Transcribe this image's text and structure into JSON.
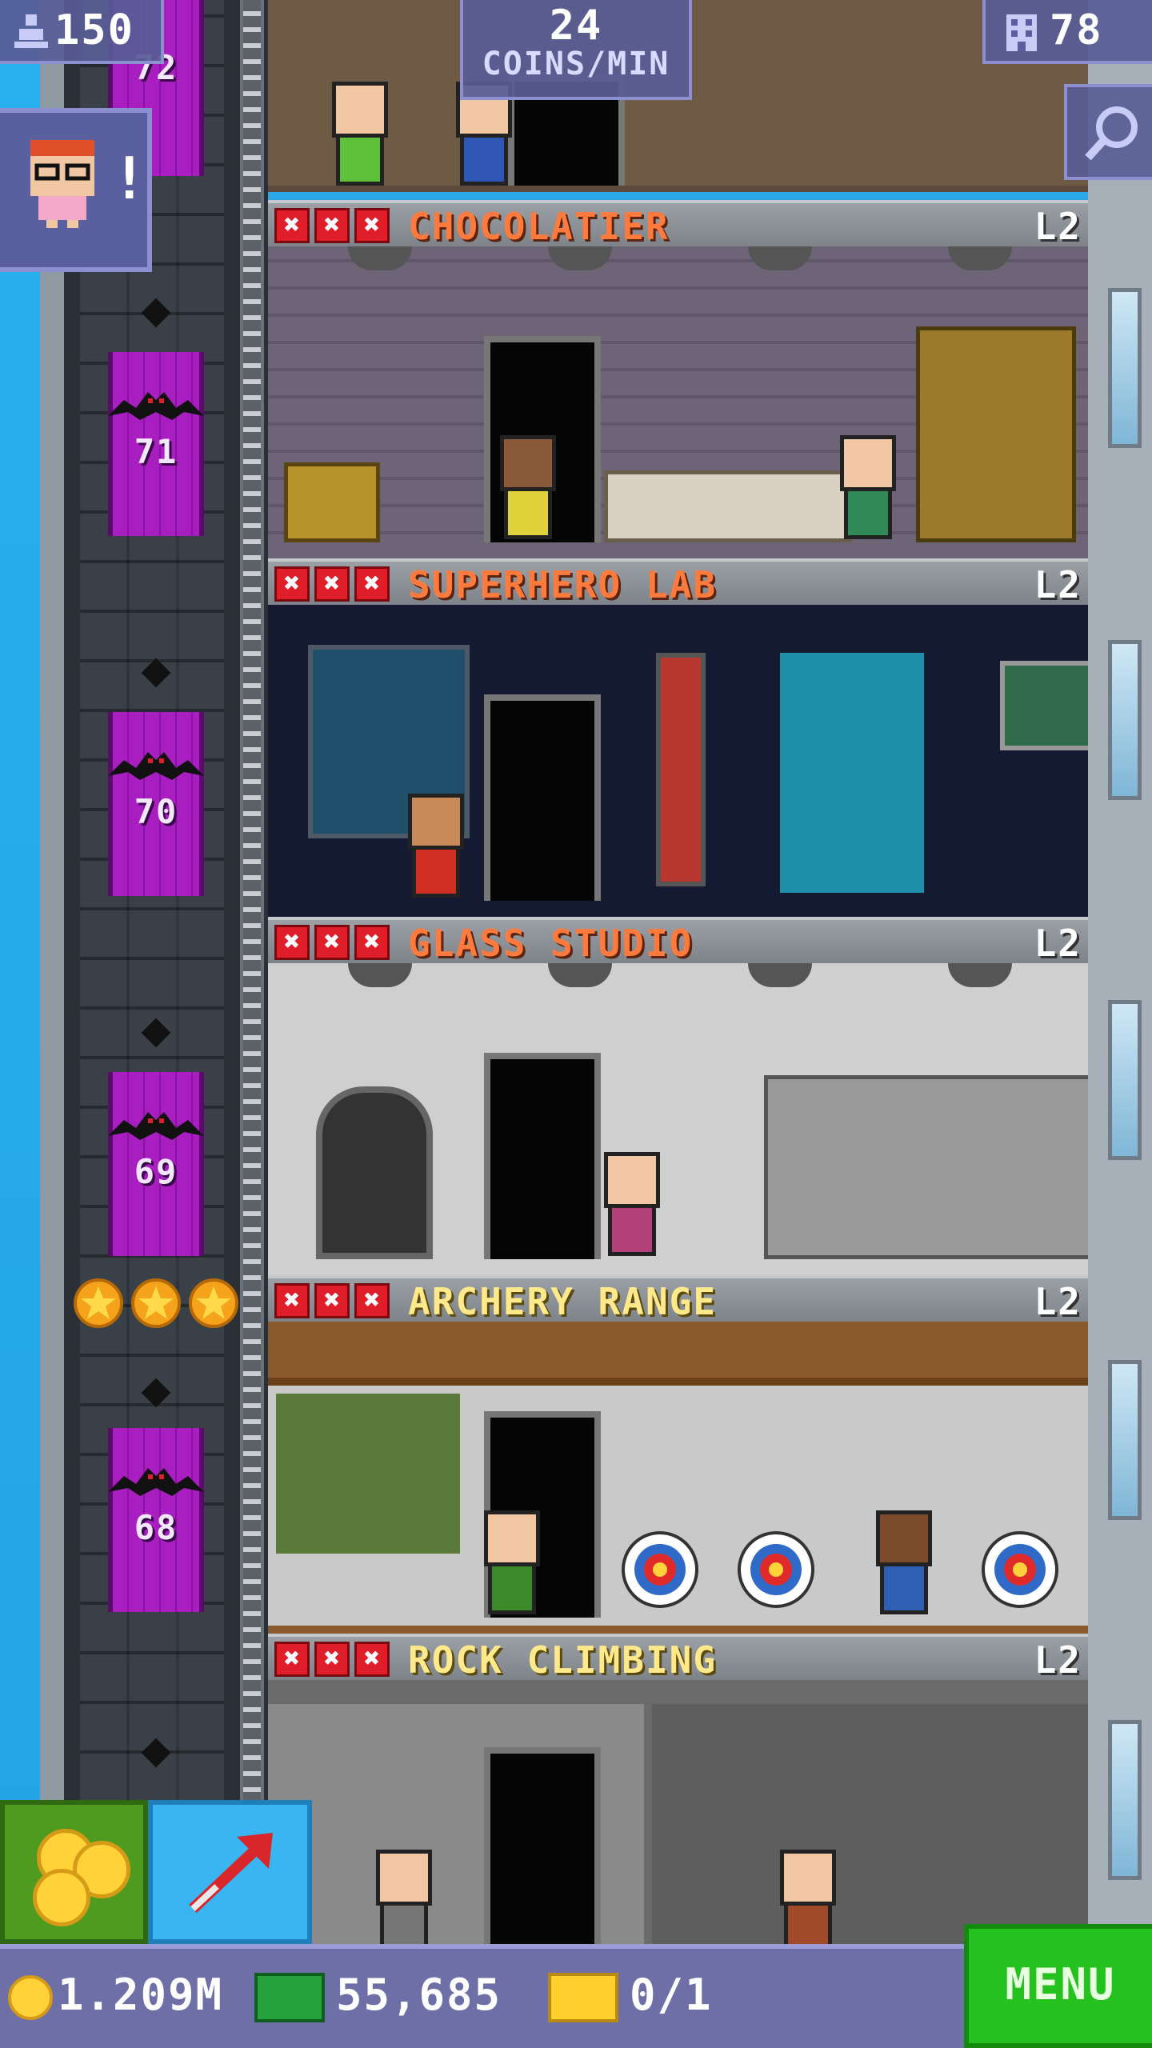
{
  "hud": {
    "population": "150",
    "coins_per_min_value": "24",
    "coins_per_min_label": "COINS/MIN",
    "floors_count": "78",
    "icons": {
      "population": "people-icon",
      "floors": "building-icon",
      "zoom": "magnify-icon"
    }
  },
  "elevator": {
    "floor_numbers": [
      "72",
      "71",
      "70",
      "69",
      "68"
    ]
  },
  "floors": [
    {
      "name": "CHOCOLATIER",
      "level": "L2",
      "name_color": "#ff7a3c",
      "stock_marks": [
        "✖",
        "✖",
        "✖"
      ]
    },
    {
      "name": "SUPERHERO LAB",
      "level": "L2",
      "name_color": "#ff7a3c",
      "stock_marks": [
        "✖",
        "✖",
        "✖"
      ]
    },
    {
      "name": "GLASS STUDIO",
      "level": "L2",
      "name_color": "#ff7a3c",
      "stock_marks": [
        "✖",
        "✖",
        "✖"
      ]
    },
    {
      "name": "ARCHERY RANGE",
      "level": "L2",
      "name_color": "#ffe98a",
      "stock_marks": [
        "✖",
        "✖",
        "✖"
      ]
    },
    {
      "name": "ROCK CLIMBING",
      "level": "L2",
      "name_color": "#ffe98a",
      "stock_marks": [
        "✖",
        "✖",
        "✖"
      ]
    }
  ],
  "alert": {
    "marker": "!"
  },
  "bottom": {
    "coins": "1.209M",
    "bux": "55,685",
    "tickets": "0/1",
    "menu_label": "MENU"
  }
}
